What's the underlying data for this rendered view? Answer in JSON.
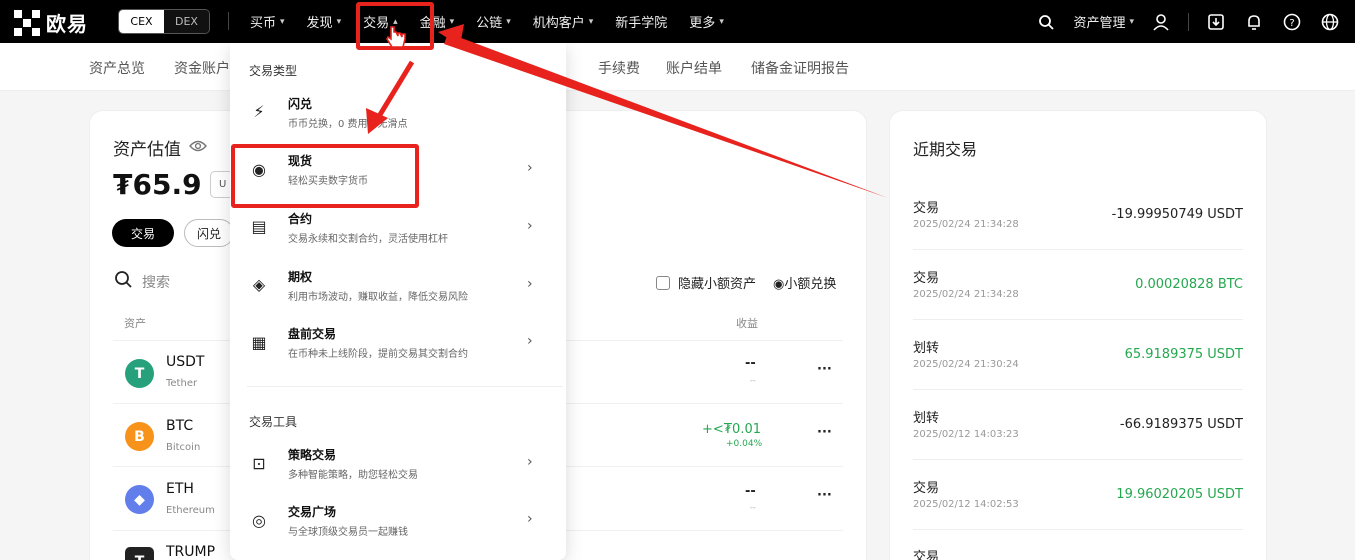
{
  "header": {
    "logo": "欧易",
    "toggle": {
      "cex": "CEX",
      "dex": "DEX"
    },
    "nav": [
      {
        "label": "买币"
      },
      {
        "label": "发现"
      },
      {
        "label": "交易"
      },
      {
        "label": "金融"
      },
      {
        "label": "公链"
      },
      {
        "label": "机构客户"
      },
      {
        "label": "新手学院"
      },
      {
        "label": "更多"
      }
    ],
    "asset_mgmt": "资产管理"
  },
  "subnav": [
    "资产总览",
    "资金账户",
    "手续费",
    "账户结单",
    "储备金证明报告"
  ],
  "assets": {
    "title": "资产估值",
    "value": "₮65.9",
    "unit_partial": "U",
    "btn_trade": "交易",
    "btn_flash": "闪兑",
    "search_placeholder": "搜索",
    "hide_small": "隐藏小额资产",
    "small_convert": "小额兑换",
    "col_asset": "资产",
    "col_pnl": "收益",
    "rows": [
      {
        "symbol": "USDT",
        "name": "Tether",
        "pnl": "--",
        "pnl_sub": "--",
        "color": "#26a17b",
        "glyph": "T"
      },
      {
        "symbol": "BTC",
        "name": "Bitcoin",
        "pnl": "+<₮0.01",
        "pnl_sub": "+0.04%",
        "color": "#f7931a",
        "glyph": "B"
      },
      {
        "symbol": "ETH",
        "name": "Ethereum",
        "pnl": "--",
        "pnl_sub": "--",
        "color": "#627eea",
        "glyph": "◆"
      },
      {
        "symbol": "TRUMP",
        "name": "",
        "pnl": "",
        "pnl_sub": "",
        "color": "#222222",
        "glyph": "T"
      }
    ],
    "more": "···"
  },
  "recent": {
    "title": "近期交易",
    "items": [
      {
        "type": "交易",
        "time": "2025/02/24 21:34:28",
        "amount": "-19.99950749 USDT",
        "color": "#222222"
      },
      {
        "type": "交易",
        "time": "2025/02/24 21:34:28",
        "amount": "0.00020828 BTC",
        "color": "#25a750"
      },
      {
        "type": "划转",
        "time": "2025/02/24 21:30:24",
        "amount": "65.9189375 USDT",
        "color": "#25a750"
      },
      {
        "type": "划转",
        "time": "2025/02/12 14:03:23",
        "amount": "-66.9189375 USDT",
        "color": "#222222"
      },
      {
        "type": "交易",
        "time": "2025/02/12 14:02:53",
        "amount": "19.96020205 USDT",
        "color": "#25a750"
      },
      {
        "type": "交易",
        "time": "",
        "amount": "",
        "color": "#222222"
      }
    ]
  },
  "dropdown": {
    "section1": "交易类型",
    "items": [
      {
        "title": "闪兑",
        "desc": "币币兑换，0 费用，无滑点",
        "icon": "flash-swap-icon",
        "glyph": "⚡",
        "arrow": false
      },
      {
        "title": "现货",
        "desc": "轻松买卖数字货币",
        "icon": "spot-icon",
        "glyph": "◉",
        "arrow": true
      },
      {
        "title": "合约",
        "desc": "交易永续和交割合约，灵活使用杠杆",
        "icon": "contract-icon",
        "glyph": "▤",
        "arrow": true
      },
      {
        "title": "期权",
        "desc": "利用市场波动，赚取收益，降低交易风险",
        "icon": "options-icon",
        "glyph": "◈",
        "arrow": true
      },
      {
        "title": "盘前交易",
        "desc": "在币种未上线阶段，提前交易其交割合约",
        "icon": "premarket-icon",
        "glyph": "▦",
        "arrow": true
      }
    ],
    "section2": "交易工具",
    "tools": [
      {
        "title": "策略交易",
        "desc": "多种智能策略，助您轻松交易",
        "icon": "bot-icon",
        "glyph": "⊡",
        "arrow": true
      },
      {
        "title": "交易广场",
        "desc": "与全球顶级交易员一起赚钱",
        "icon": "square-icon",
        "glyph": "◎",
        "arrow": true
      }
    ]
  },
  "colors": {
    "accent_red": "#e8231d",
    "green": "#25a750"
  }
}
